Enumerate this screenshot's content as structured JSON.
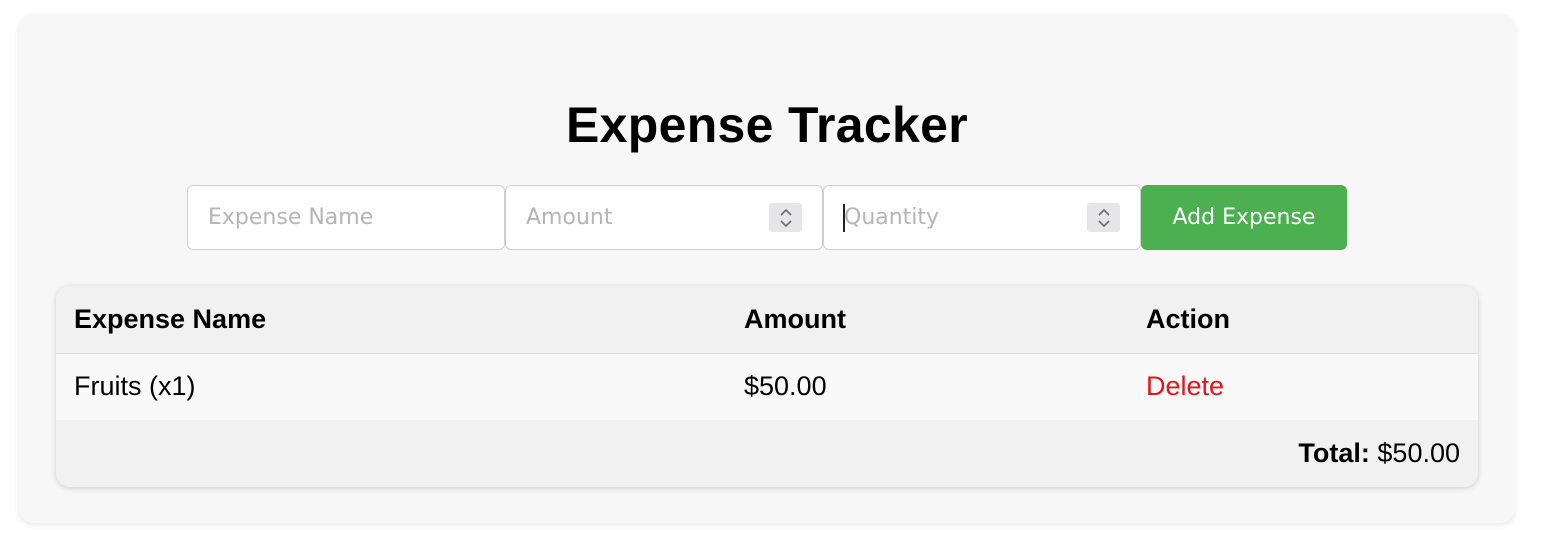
{
  "header": {
    "title": "Expense Tracker"
  },
  "form": {
    "name_placeholder": "Expense Name",
    "amount_placeholder": "Amount",
    "quantity_placeholder": "Quantity",
    "add_button_label": "Add Expense"
  },
  "table": {
    "headers": {
      "name": "Expense Name",
      "amount": "Amount",
      "action": "Action"
    },
    "rows": [
      {
        "name": "Fruits (x1)",
        "amount": "$50.00",
        "action": "Delete"
      }
    ],
    "footer": {
      "total_label": "Total:",
      "total_value": "$50.00"
    }
  },
  "colors": {
    "accent": "#4caf50",
    "delete": "#e0161a"
  },
  "icons": {
    "spinner": "up-down-stepper-icon"
  }
}
